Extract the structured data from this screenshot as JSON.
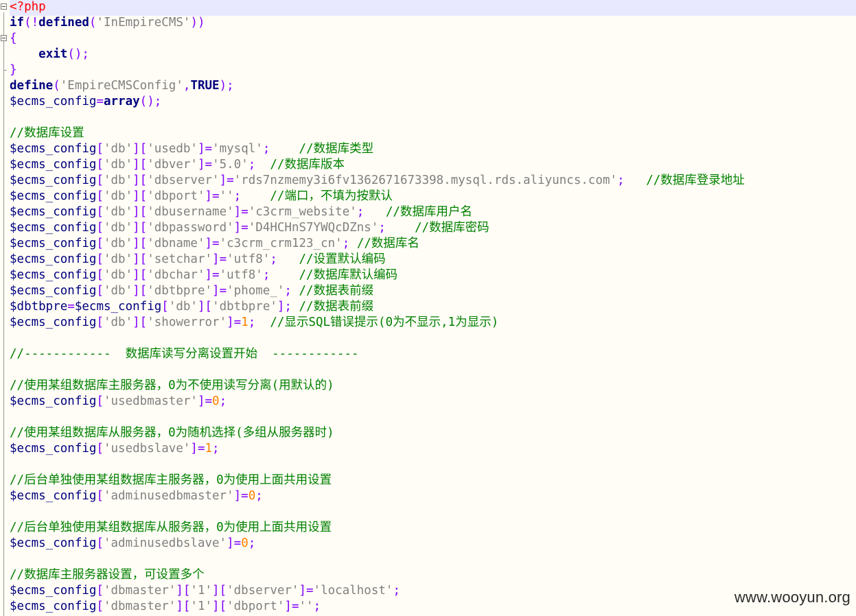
{
  "watermark": "www.wooyun.org",
  "lines": [
    {
      "current": true,
      "tokens": [
        {
          "t": "tag",
          "v": "<?php"
        }
      ]
    },
    {
      "tokens": [
        {
          "t": "kw",
          "v": "if"
        },
        {
          "t": "op",
          "v": "(!"
        },
        {
          "t": "kw",
          "v": "defined"
        },
        {
          "t": "op",
          "v": "("
        },
        {
          "t": "str",
          "v": "'InEmpireCMS'"
        },
        {
          "t": "op",
          "v": "))"
        }
      ]
    },
    {
      "tokens": [
        {
          "t": "op",
          "v": "{"
        }
      ]
    },
    {
      "tokens": [
        {
          "t": "plain",
          "v": "    "
        },
        {
          "t": "kw",
          "v": "exit"
        },
        {
          "t": "op",
          "v": "();"
        }
      ]
    },
    {
      "tokens": [
        {
          "t": "op",
          "v": "}"
        }
      ]
    },
    {
      "tokens": [
        {
          "t": "kw",
          "v": "define"
        },
        {
          "t": "op",
          "v": "("
        },
        {
          "t": "str",
          "v": "'EmpireCMSConfig'"
        },
        {
          "t": "op",
          "v": ","
        },
        {
          "t": "kw",
          "v": "TRUE"
        },
        {
          "t": "op",
          "v": ");"
        }
      ]
    },
    {
      "tokens": [
        {
          "t": "var",
          "v": "$ecms_config"
        },
        {
          "t": "op",
          "v": "="
        },
        {
          "t": "kw",
          "v": "array"
        },
        {
          "t": "op",
          "v": "();"
        }
      ]
    },
    {
      "tokens": []
    },
    {
      "tokens": [
        {
          "t": "cmt",
          "v": "//数据库设置"
        }
      ]
    },
    {
      "tokens": [
        {
          "t": "var",
          "v": "$ecms_config"
        },
        {
          "t": "op",
          "v": "["
        },
        {
          "t": "str",
          "v": "'db'"
        },
        {
          "t": "op",
          "v": "]["
        },
        {
          "t": "str",
          "v": "'usedb'"
        },
        {
          "t": "op",
          "v": "]="
        },
        {
          "t": "str",
          "v": "'mysql'"
        },
        {
          "t": "op",
          "v": ";"
        },
        {
          "t": "plain",
          "v": "    "
        },
        {
          "t": "cmt",
          "v": "//数据库类型"
        }
      ]
    },
    {
      "tokens": [
        {
          "t": "var",
          "v": "$ecms_config"
        },
        {
          "t": "op",
          "v": "["
        },
        {
          "t": "str",
          "v": "'db'"
        },
        {
          "t": "op",
          "v": "]["
        },
        {
          "t": "str",
          "v": "'dbver'"
        },
        {
          "t": "op",
          "v": "]="
        },
        {
          "t": "str",
          "v": "'5.0'"
        },
        {
          "t": "op",
          "v": ";"
        },
        {
          "t": "plain",
          "v": "  "
        },
        {
          "t": "cmt",
          "v": "//数据库版本"
        }
      ]
    },
    {
      "tokens": [
        {
          "t": "var",
          "v": "$ecms_config"
        },
        {
          "t": "op",
          "v": "["
        },
        {
          "t": "str",
          "v": "'db'"
        },
        {
          "t": "op",
          "v": "]["
        },
        {
          "t": "str",
          "v": "'dbserver'"
        },
        {
          "t": "op",
          "v": "]="
        },
        {
          "t": "str",
          "v": "'rds7nzmemy3i6fv1362671673398.mysql.rds.aliyuncs.com'"
        },
        {
          "t": "op",
          "v": ";"
        },
        {
          "t": "plain",
          "v": "   "
        },
        {
          "t": "cmt",
          "v": "//数据库登录地址"
        }
      ]
    },
    {
      "tokens": [
        {
          "t": "var",
          "v": "$ecms_config"
        },
        {
          "t": "op",
          "v": "["
        },
        {
          "t": "str",
          "v": "'db'"
        },
        {
          "t": "op",
          "v": "]["
        },
        {
          "t": "str",
          "v": "'dbport'"
        },
        {
          "t": "op",
          "v": "]="
        },
        {
          "t": "str",
          "v": "''"
        },
        {
          "t": "op",
          "v": ";"
        },
        {
          "t": "plain",
          "v": "    "
        },
        {
          "t": "cmt",
          "v": "//端口，不填为按默认"
        }
      ]
    },
    {
      "tokens": [
        {
          "t": "var",
          "v": "$ecms_config"
        },
        {
          "t": "op",
          "v": "["
        },
        {
          "t": "str",
          "v": "'db'"
        },
        {
          "t": "op",
          "v": "]["
        },
        {
          "t": "str",
          "v": "'dbusername'"
        },
        {
          "t": "op",
          "v": "]="
        },
        {
          "t": "str",
          "v": "'c3crm_website'"
        },
        {
          "t": "op",
          "v": ";"
        },
        {
          "t": "plain",
          "v": "   "
        },
        {
          "t": "cmt",
          "v": "//数据库用户名"
        }
      ]
    },
    {
      "tokens": [
        {
          "t": "var",
          "v": "$ecms_config"
        },
        {
          "t": "op",
          "v": "["
        },
        {
          "t": "str",
          "v": "'db'"
        },
        {
          "t": "op",
          "v": "]["
        },
        {
          "t": "str",
          "v": "'dbpassword'"
        },
        {
          "t": "op",
          "v": "]="
        },
        {
          "t": "str",
          "v": "'D4HCHnS7YWQcDZns'"
        },
        {
          "t": "op",
          "v": ";"
        },
        {
          "t": "plain",
          "v": "    "
        },
        {
          "t": "cmt",
          "v": "//数据库密码"
        }
      ]
    },
    {
      "tokens": [
        {
          "t": "var",
          "v": "$ecms_config"
        },
        {
          "t": "op",
          "v": "["
        },
        {
          "t": "str",
          "v": "'db'"
        },
        {
          "t": "op",
          "v": "]["
        },
        {
          "t": "str",
          "v": "'dbname'"
        },
        {
          "t": "op",
          "v": "]="
        },
        {
          "t": "str",
          "v": "'c3crm_crm123_cn'"
        },
        {
          "t": "op",
          "v": ";"
        },
        {
          "t": "plain",
          "v": " "
        },
        {
          "t": "cmt",
          "v": "//数据库名"
        }
      ]
    },
    {
      "tokens": [
        {
          "t": "var",
          "v": "$ecms_config"
        },
        {
          "t": "op",
          "v": "["
        },
        {
          "t": "str",
          "v": "'db'"
        },
        {
          "t": "op",
          "v": "]["
        },
        {
          "t": "str",
          "v": "'setchar'"
        },
        {
          "t": "op",
          "v": "]="
        },
        {
          "t": "str",
          "v": "'utf8'"
        },
        {
          "t": "op",
          "v": ";"
        },
        {
          "t": "plain",
          "v": "   "
        },
        {
          "t": "cmt",
          "v": "//设置默认编码"
        }
      ]
    },
    {
      "tokens": [
        {
          "t": "var",
          "v": "$ecms_config"
        },
        {
          "t": "op",
          "v": "["
        },
        {
          "t": "str",
          "v": "'db'"
        },
        {
          "t": "op",
          "v": "]["
        },
        {
          "t": "str",
          "v": "'dbchar'"
        },
        {
          "t": "op",
          "v": "]="
        },
        {
          "t": "str",
          "v": "'utf8'"
        },
        {
          "t": "op",
          "v": ";"
        },
        {
          "t": "plain",
          "v": "    "
        },
        {
          "t": "cmt",
          "v": "//数据库默认编码"
        }
      ]
    },
    {
      "tokens": [
        {
          "t": "var",
          "v": "$ecms_config"
        },
        {
          "t": "op",
          "v": "["
        },
        {
          "t": "str",
          "v": "'db'"
        },
        {
          "t": "op",
          "v": "]["
        },
        {
          "t": "str",
          "v": "'dbtbpre'"
        },
        {
          "t": "op",
          "v": "]="
        },
        {
          "t": "str",
          "v": "'phome_'"
        },
        {
          "t": "op",
          "v": ";"
        },
        {
          "t": "plain",
          "v": " "
        },
        {
          "t": "cmt",
          "v": "//数据表前缀"
        }
      ]
    },
    {
      "tokens": [
        {
          "t": "var",
          "v": "$dbtbpre"
        },
        {
          "t": "op",
          "v": "="
        },
        {
          "t": "var",
          "v": "$ecms_config"
        },
        {
          "t": "op",
          "v": "["
        },
        {
          "t": "str",
          "v": "'db'"
        },
        {
          "t": "op",
          "v": "]["
        },
        {
          "t": "str",
          "v": "'dbtbpre'"
        },
        {
          "t": "op",
          "v": "];"
        },
        {
          "t": "plain",
          "v": " "
        },
        {
          "t": "cmt",
          "v": "//数据表前缀"
        }
      ]
    },
    {
      "tokens": [
        {
          "t": "var",
          "v": "$ecms_config"
        },
        {
          "t": "op",
          "v": "["
        },
        {
          "t": "str",
          "v": "'db'"
        },
        {
          "t": "op",
          "v": "]["
        },
        {
          "t": "str",
          "v": "'showerror'"
        },
        {
          "t": "op",
          "v": "]="
        },
        {
          "t": "num",
          "v": "1"
        },
        {
          "t": "op",
          "v": ";"
        },
        {
          "t": "plain",
          "v": "  "
        },
        {
          "t": "cmt",
          "v": "//显示SQL错误提示(0为不显示,1为显示)"
        }
      ]
    },
    {
      "tokens": []
    },
    {
      "tokens": [
        {
          "t": "cmt",
          "v": "//------------  数据库读写分离设置开始  ------------"
        }
      ]
    },
    {
      "tokens": []
    },
    {
      "tokens": [
        {
          "t": "cmt",
          "v": "//使用某组数据库主服务器，0为不使用读写分离(用默认的)"
        }
      ]
    },
    {
      "tokens": [
        {
          "t": "var",
          "v": "$ecms_config"
        },
        {
          "t": "op",
          "v": "["
        },
        {
          "t": "str",
          "v": "'usedbmaster'"
        },
        {
          "t": "op",
          "v": "]="
        },
        {
          "t": "num",
          "v": "0"
        },
        {
          "t": "op",
          "v": ";"
        }
      ]
    },
    {
      "tokens": []
    },
    {
      "tokens": [
        {
          "t": "cmt",
          "v": "//使用某组数据库从服务器，0为随机选择(多组从服务器时)"
        }
      ]
    },
    {
      "tokens": [
        {
          "t": "var",
          "v": "$ecms_config"
        },
        {
          "t": "op",
          "v": "["
        },
        {
          "t": "str",
          "v": "'usedbslave'"
        },
        {
          "t": "op",
          "v": "]="
        },
        {
          "t": "num",
          "v": "1"
        },
        {
          "t": "op",
          "v": ";"
        }
      ]
    },
    {
      "tokens": []
    },
    {
      "tokens": [
        {
          "t": "cmt",
          "v": "//后台单独使用某组数据库主服务器，0为使用上面共用设置"
        }
      ]
    },
    {
      "tokens": [
        {
          "t": "var",
          "v": "$ecms_config"
        },
        {
          "t": "op",
          "v": "["
        },
        {
          "t": "str",
          "v": "'adminusedbmaster'"
        },
        {
          "t": "op",
          "v": "]="
        },
        {
          "t": "num",
          "v": "0"
        },
        {
          "t": "op",
          "v": ";"
        }
      ]
    },
    {
      "tokens": []
    },
    {
      "tokens": [
        {
          "t": "cmt",
          "v": "//后台单独使用某组数据库从服务器，0为使用上面共用设置"
        }
      ]
    },
    {
      "tokens": [
        {
          "t": "var",
          "v": "$ecms_config"
        },
        {
          "t": "op",
          "v": "["
        },
        {
          "t": "str",
          "v": "'adminusedbslave'"
        },
        {
          "t": "op",
          "v": "]="
        },
        {
          "t": "num",
          "v": "0"
        },
        {
          "t": "op",
          "v": ";"
        }
      ]
    },
    {
      "tokens": []
    },
    {
      "tokens": [
        {
          "t": "cmt",
          "v": "//数据库主服务器设置，可设置多个"
        }
      ]
    },
    {
      "tokens": [
        {
          "t": "var",
          "v": "$ecms_config"
        },
        {
          "t": "op",
          "v": "["
        },
        {
          "t": "str",
          "v": "'dbmaster'"
        },
        {
          "t": "op",
          "v": "]["
        },
        {
          "t": "str",
          "v": "'1'"
        },
        {
          "t": "op",
          "v": "]["
        },
        {
          "t": "str",
          "v": "'dbserver'"
        },
        {
          "t": "op",
          "v": "]="
        },
        {
          "t": "str",
          "v": "'localhost'"
        },
        {
          "t": "op",
          "v": ";"
        }
      ]
    },
    {
      "tokens": [
        {
          "t": "var",
          "v": "$ecms_config"
        },
        {
          "t": "op",
          "v": "["
        },
        {
          "t": "str",
          "v": "'dbmaster'"
        },
        {
          "t": "op",
          "v": "]["
        },
        {
          "t": "str",
          "v": "'1'"
        },
        {
          "t": "op",
          "v": "]["
        },
        {
          "t": "str",
          "v": "'dbport'"
        },
        {
          "t": "op",
          "v": "]="
        },
        {
          "t": "str",
          "v": "''"
        },
        {
          "t": "op",
          "v": ";"
        }
      ]
    }
  ]
}
